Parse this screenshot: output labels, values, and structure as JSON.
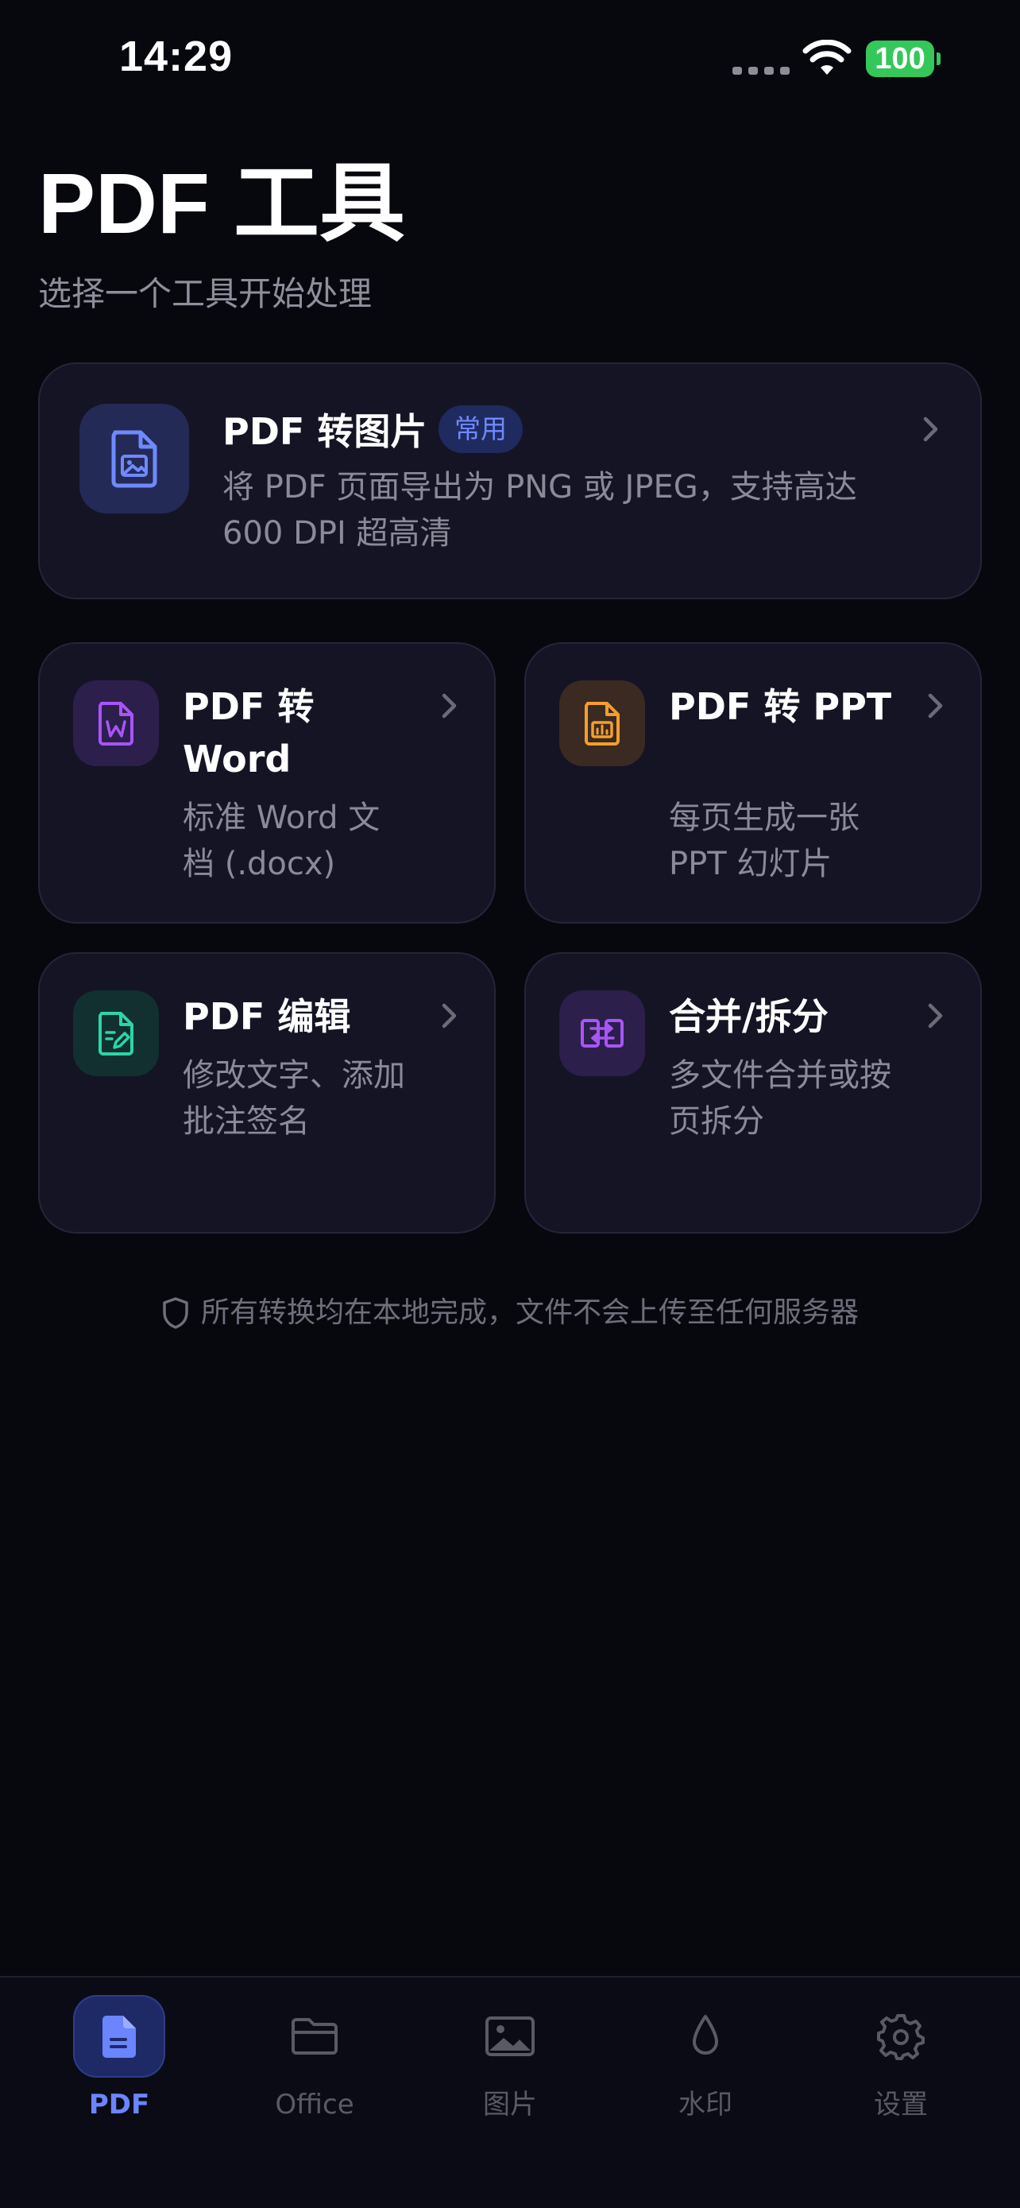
{
  "status_bar": {
    "time": "14:29",
    "battery": "100"
  },
  "header": {
    "title": "PDF 工具",
    "subtitle": "选择一个工具开始处理"
  },
  "featured_tool": {
    "title": "PDF 转图片",
    "badge": "常用",
    "description": "将 PDF 页面导出为 PNG 或 JPEG，支持高达 600 DPI 超高清",
    "icon": "image-file-icon",
    "accent": "#6f89ff"
  },
  "tools": [
    {
      "title": "PDF 转 Word",
      "description": "标准 Word 文档 (.docx)",
      "icon": "word-file-icon",
      "accent": "#a855f7"
    },
    {
      "title": "PDF 转 PPT",
      "description": "每页生成一张 PPT 幻灯片",
      "icon": "ppt-file-icon",
      "accent": "#f59e2c"
    },
    {
      "title": "PDF 编辑",
      "description": "修改文字、添加批注签名",
      "icon": "edit-file-icon",
      "accent": "#2dd4a7"
    },
    {
      "title": "合并/拆分",
      "description": "多文件合并或按页拆分",
      "icon": "merge-split-icon",
      "accent": "#a855f7"
    }
  ],
  "privacy_note": "所有转换均在本地完成，文件不会上传至任何服务器",
  "tab_bar": {
    "active": "PDF",
    "tabs": [
      {
        "label": "PDF",
        "icon": "document-icon"
      },
      {
        "label": "Office",
        "icon": "folder-icon"
      },
      {
        "label": "图片",
        "icon": "image-icon"
      },
      {
        "label": "水印",
        "icon": "water-drop-icon"
      },
      {
        "label": "设置",
        "icon": "gear-icon"
      }
    ]
  },
  "colors": {
    "background": "#07070e",
    "card": "#141425",
    "active_tab": "#6b85ff",
    "battery": "#34c759"
  }
}
